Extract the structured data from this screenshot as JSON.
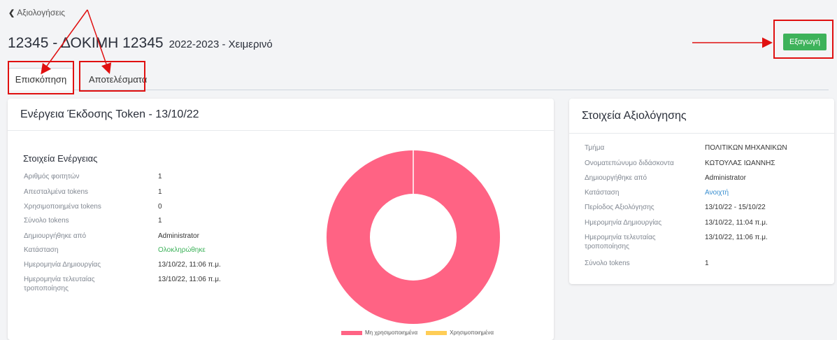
{
  "nav": {
    "back_label": "Αξιολογήσεις"
  },
  "header": {
    "title": "12345 - ΔΟΚΙΜΗ 12345",
    "subtitle": "2022-2023 - Χειμερινό",
    "export_label": "Εξαγωγή",
    "accent_color": "#3db25a"
  },
  "tabs": [
    {
      "label": "Επισκόπηση",
      "active": true
    },
    {
      "label": "Αποτελέσματα",
      "active": false
    }
  ],
  "token_card": {
    "title": "Ενέργεια Έκδοσης Token - 13/10/22",
    "section_title": "Στοιχεία Ενέργειας",
    "rows": [
      {
        "key": "Αριθμός φοιτητών",
        "value": "1"
      },
      {
        "key": "Απεσταλμένα tokens",
        "value": "1"
      },
      {
        "key": "Χρησιμοποιημένα tokens",
        "value": "0"
      },
      {
        "key": "Σύνολο tokens",
        "value": "1"
      },
      {
        "key": "Δημιουργήθηκε από",
        "value": "Administrator"
      },
      {
        "key": "Κατάσταση",
        "value": "Ολοκληρώθηκε",
        "color": "#3db25a"
      },
      {
        "key": "Ημερομηνία Δημιουργίας",
        "value": "13/10/22, 11:06 π.μ."
      },
      {
        "key": "Ημερομηνία τελευταίας τροποποίησης",
        "value": "13/10/22, 11:06 π.μ."
      }
    ]
  },
  "chart_data": {
    "type": "pie",
    "categories": [
      "Μη χρησιμοποιημένα",
      "Χρησιμοποιημένα"
    ],
    "values": [
      1,
      0
    ],
    "colors": [
      "#ff6384",
      "#ffcd56"
    ],
    "legend": "bottom"
  },
  "evaluation_card": {
    "title": "Στοιχεία Αξιολόγησης",
    "rows": [
      {
        "key": "Τμήμα",
        "value": "ΠΟΛΙΤΙΚΩΝ ΜΗΧΑΝΙΚΩΝ"
      },
      {
        "key": "Ονοματεπώνυμο διδάσκοντα",
        "value": "ΚΩΤΟΥΛΑΣ ΙΩΑΝΝΗΣ"
      },
      {
        "key": "Δημιουργήθηκε από",
        "value": "Administrator"
      },
      {
        "key": "Κατάσταση",
        "value": "Ανοιχτή",
        "color": "#3a8fd0"
      },
      {
        "key": "Περίοδος Αξιολόγησης",
        "value": "13/10/22 - 15/10/22"
      },
      {
        "key": "Ημερομηνία Δημιουργίας",
        "value": "13/10/22, 11:04 π.μ."
      },
      {
        "key": "Ημερομηνία τελευταίας τροποποίησης",
        "value": "13/10/22, 11:06 π.μ."
      },
      {
        "key": "Σύνολο tokens",
        "value": "1"
      }
    ]
  }
}
